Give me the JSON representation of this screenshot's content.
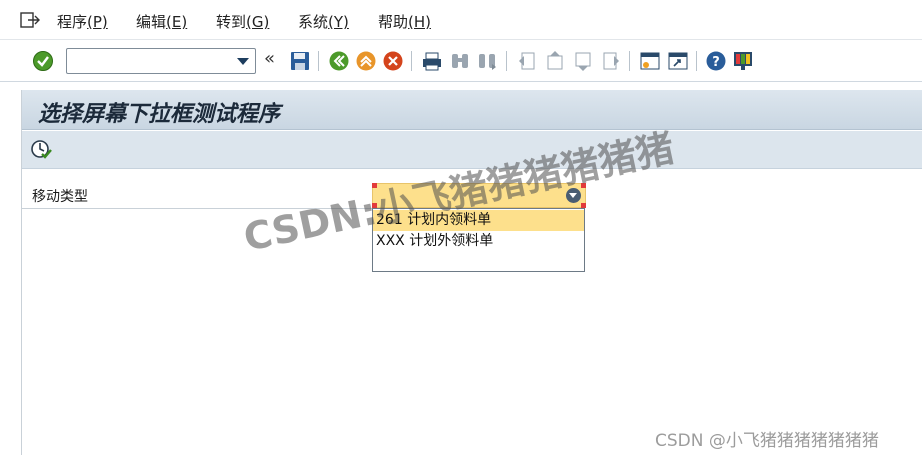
{
  "menubar": {
    "items": [
      {
        "label": "程序",
        "mnemonic": "(P)"
      },
      {
        "label": "编辑",
        "mnemonic": "(E)"
      },
      {
        "label": "转到",
        "mnemonic": "(G)"
      },
      {
        "label": "系统",
        "mnemonic": "(Y)"
      },
      {
        "label": "帮助",
        "mnemonic": "(H)"
      }
    ]
  },
  "toolbar": {
    "command_value": "",
    "chevron": "«",
    "icons": [
      "check-icon",
      "save-icon",
      "back-icon",
      "exit-icon",
      "cancel-icon",
      "print-icon",
      "find-icon",
      "find-next-icon",
      "first-page-icon",
      "prev-page-icon",
      "next-page-icon",
      "last-page-icon",
      "new-session-icon",
      "shortcut-icon",
      "help-icon",
      "layout-icon"
    ]
  },
  "title": "选择屏幕下拉框测试程序",
  "form": {
    "field_label": "移动类型",
    "options": [
      {
        "code": "261",
        "text": "计划内领料单"
      },
      {
        "code": "XXX",
        "text": "计划外领料单"
      }
    ]
  },
  "watermark": {
    "overlay": "CSDN:小飞猪猪猪猪猪猪",
    "footer": "CSDN @小飞猪猪猪猪猪猪猪"
  },
  "colors": {
    "select_highlight": "#fde08c",
    "titlebar": "#c9d6e2"
  }
}
